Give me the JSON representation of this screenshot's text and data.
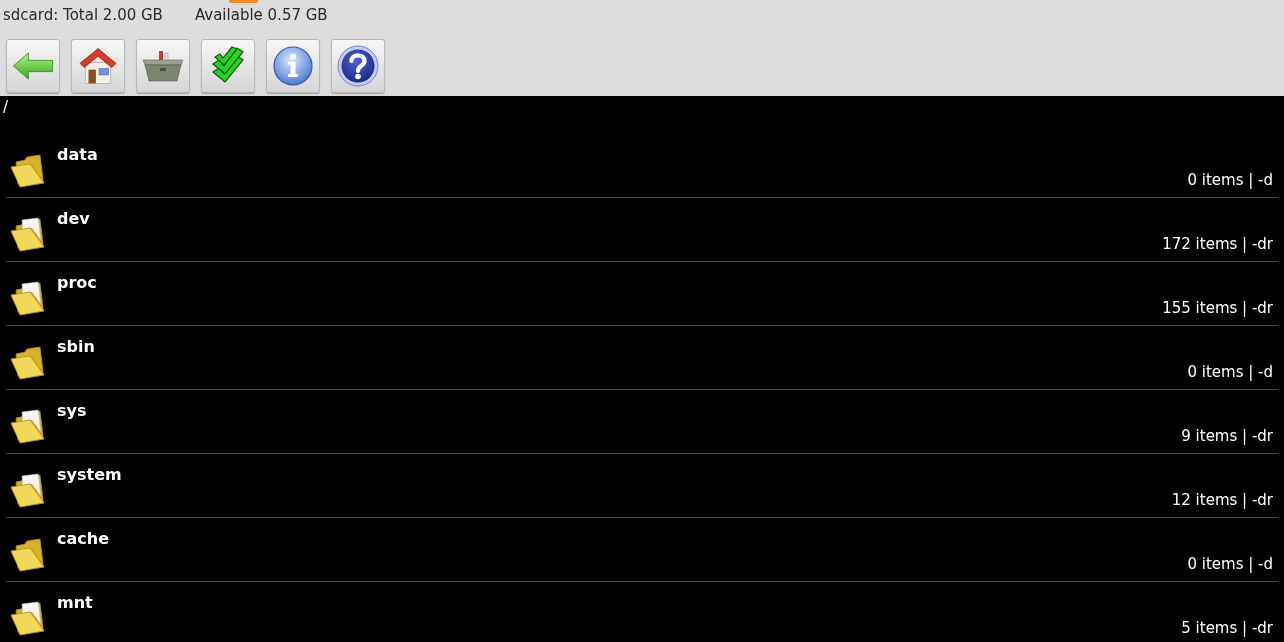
{
  "status": {
    "storage": "sdcard: Total 2.00 GB",
    "available": "Available 0.57 GB"
  },
  "toolbar": {
    "buttons": [
      {
        "kind": "back"
      },
      {
        "kind": "home"
      },
      {
        "kind": "tools"
      },
      {
        "kind": "multiselect"
      },
      {
        "kind": "info"
      },
      {
        "kind": "help"
      }
    ]
  },
  "path": "/",
  "files": [
    {
      "name": "data",
      "info": "0 items | -d",
      "kind": "empty"
    },
    {
      "name": "dev",
      "info": "172 items | -dr",
      "kind": "filled"
    },
    {
      "name": "proc",
      "info": "155 items | -dr",
      "kind": "filled"
    },
    {
      "name": "sbin",
      "info": "0 items | -d",
      "kind": "empty"
    },
    {
      "name": "sys",
      "info": "9 items | -dr",
      "kind": "filled"
    },
    {
      "name": "system",
      "info": "12 items | -dr",
      "kind": "filled"
    },
    {
      "name": "cache",
      "info": "0 items | -d",
      "kind": "empty"
    },
    {
      "name": "mnt",
      "info": "5 items | -dr",
      "kind": "filled"
    }
  ]
}
